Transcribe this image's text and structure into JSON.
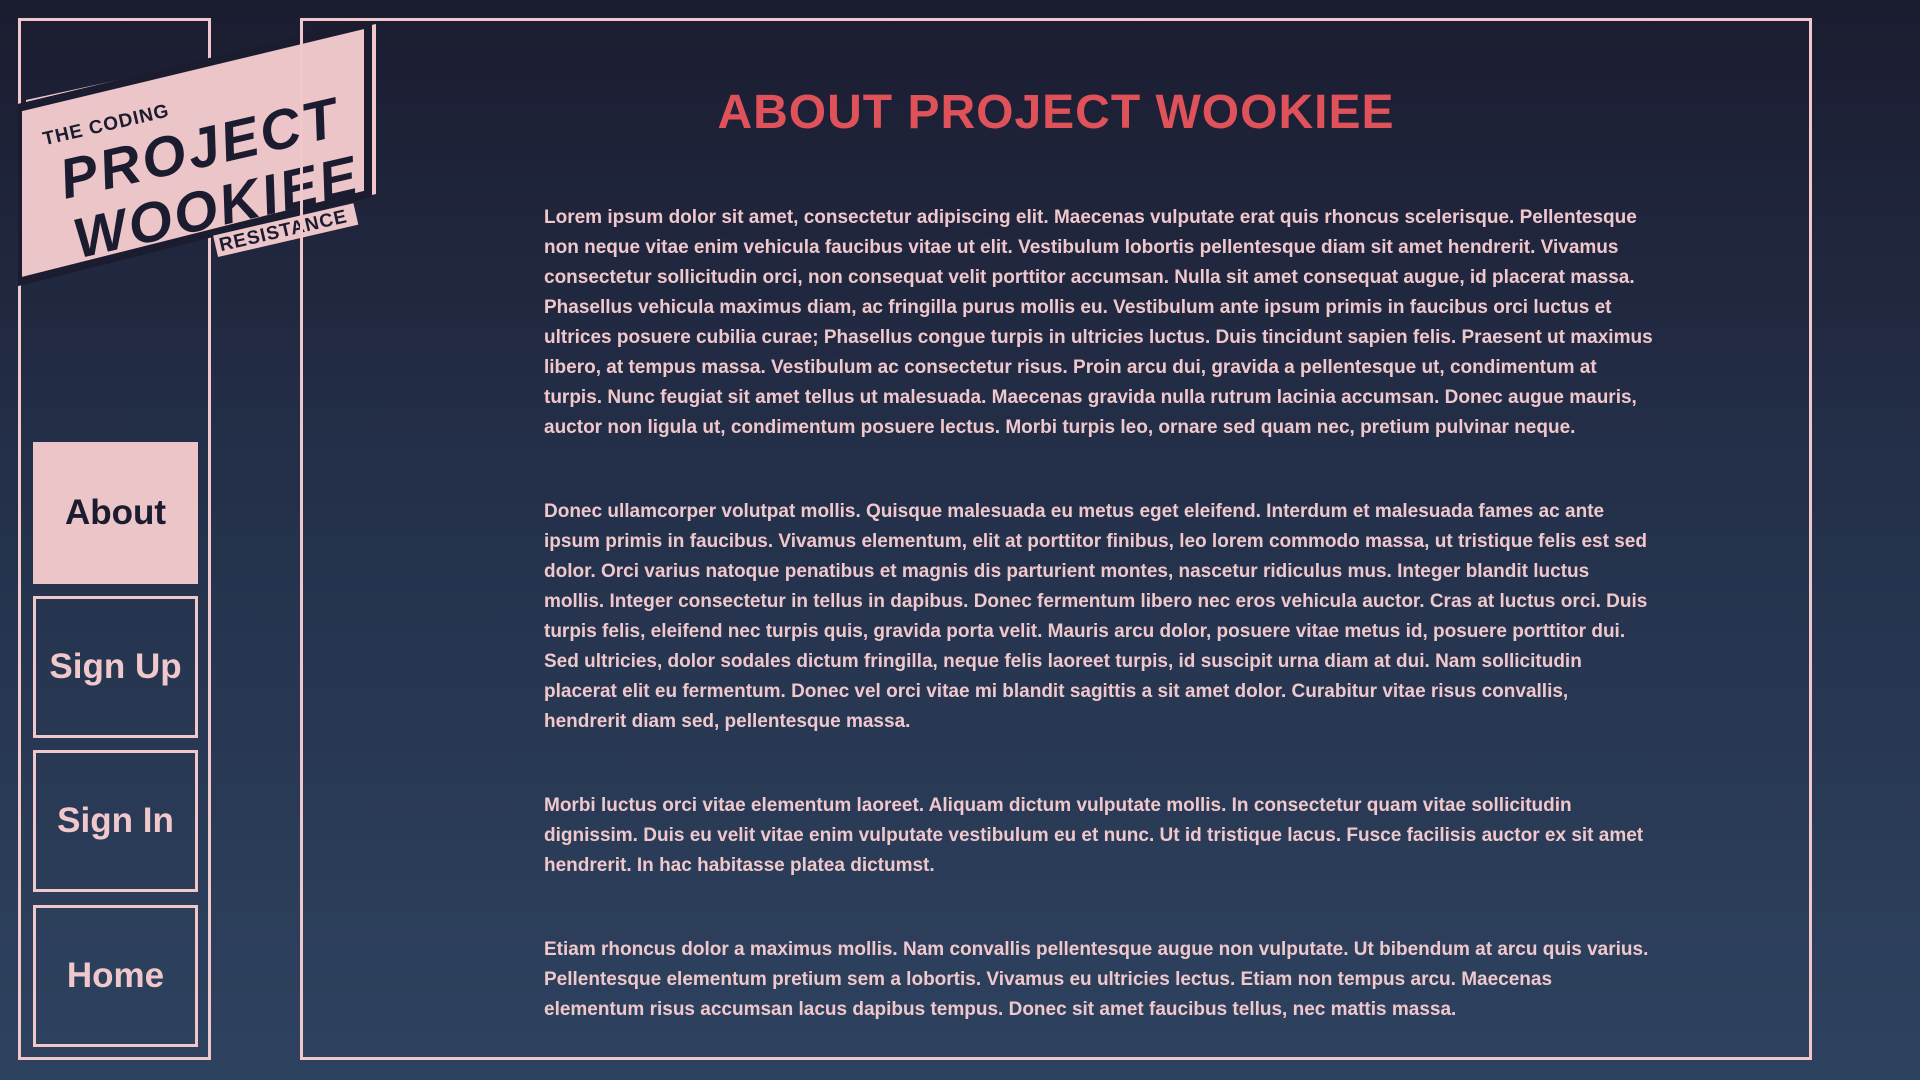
{
  "logo": {
    "top_text": "THE CODING",
    "line1": "PROJECT",
    "line2": "WOOKIEE",
    "bottom_text": "RESISTANCE"
  },
  "nav": {
    "about": "About",
    "signup": "Sign Up",
    "signin": "Sign In",
    "home": "Home",
    "active": "about"
  },
  "main": {
    "title": "ABOUT PROJECT WOOKIEE",
    "paragraphs": [
      "Lorem ipsum dolor sit amet, consectetur adipiscing elit. Maecenas vulputate erat quis rhoncus scelerisque. Pellentesque non neque vitae enim vehicula faucibus vitae ut elit. Vestibulum lobortis pellentesque diam sit amet hendrerit. Vivamus consectetur sollicitudin orci, non consequat velit porttitor accumsan. Nulla sit amet consequat augue, id placerat massa. Phasellus vehicula maximus diam, ac fringilla purus mollis eu. Vestibulum ante ipsum primis in faucibus orci luctus et ultrices posuere cubilia curae; Phasellus congue turpis in ultricies luctus. Duis tincidunt sapien felis. Praesent ut maximus libero, at tempus massa. Vestibulum ac consectetur risus. Proin arcu dui, gravida a pellentesque ut, condimentum at turpis. Nunc feugiat sit amet tellus ut malesuada. Maecenas gravida nulla rutrum lacinia accumsan. Donec augue mauris, auctor non ligula ut, condimentum posuere lectus. Morbi turpis leo, ornare sed quam nec, pretium pulvinar neque.",
      "Donec ullamcorper volutpat mollis. Quisque malesuada eu metus eget eleifend. Interdum et malesuada fames ac ante ipsum primis in faucibus. Vivamus elementum, elit at porttitor finibus, leo lorem commodo massa, ut tristique felis est sed dolor. Orci varius natoque penatibus et magnis dis parturient montes, nascetur ridiculus mus. Integer blandit luctus mollis. Integer consectetur in tellus in dapibus. Donec fermentum libero nec eros vehicula auctor. Cras at luctus orci. Duis turpis felis, eleifend nec turpis quis, gravida porta velit. Mauris arcu dolor, posuere vitae metus id, posuere porttitor dui. Sed ultricies, dolor sodales dictum fringilla, neque felis laoreet turpis, id suscipit urna diam at dui. Nam sollicitudin placerat elit eu fermentum. Donec vel orci vitae mi blandit sagittis a sit amet dolor. Curabitur vitae risus convallis, hendrerit diam sed, pellentesque massa.",
      "Morbi luctus orci vitae elementum laoreet. Aliquam dictum vulputate mollis. In consectetur quam vitae sollicitudin dignissim. Duis eu velit vitae enim vulputate vestibulum eu et nunc. Ut id tristique lacus. Fusce facilisis auctor ex sit amet hendrerit. In hac habitasse platea dictumst.",
      "Etiam rhoncus dolor a maximus mollis. Nam convallis pellentesque augue non vulputate. Ut bibendum at arcu quis varius. Pellentesque elementum pretium sem a lobortis. Vivamus eu ultricies lectus. Etiam non tempus arcu. Maecenas elementum risus accumsan lacus dapibus tempus. Donec sit amet faucibus tellus, nec mattis massa."
    ]
  },
  "colors": {
    "accent": "#e0525a",
    "pink": "#f0c8cc",
    "navy": "#1b1c30"
  }
}
